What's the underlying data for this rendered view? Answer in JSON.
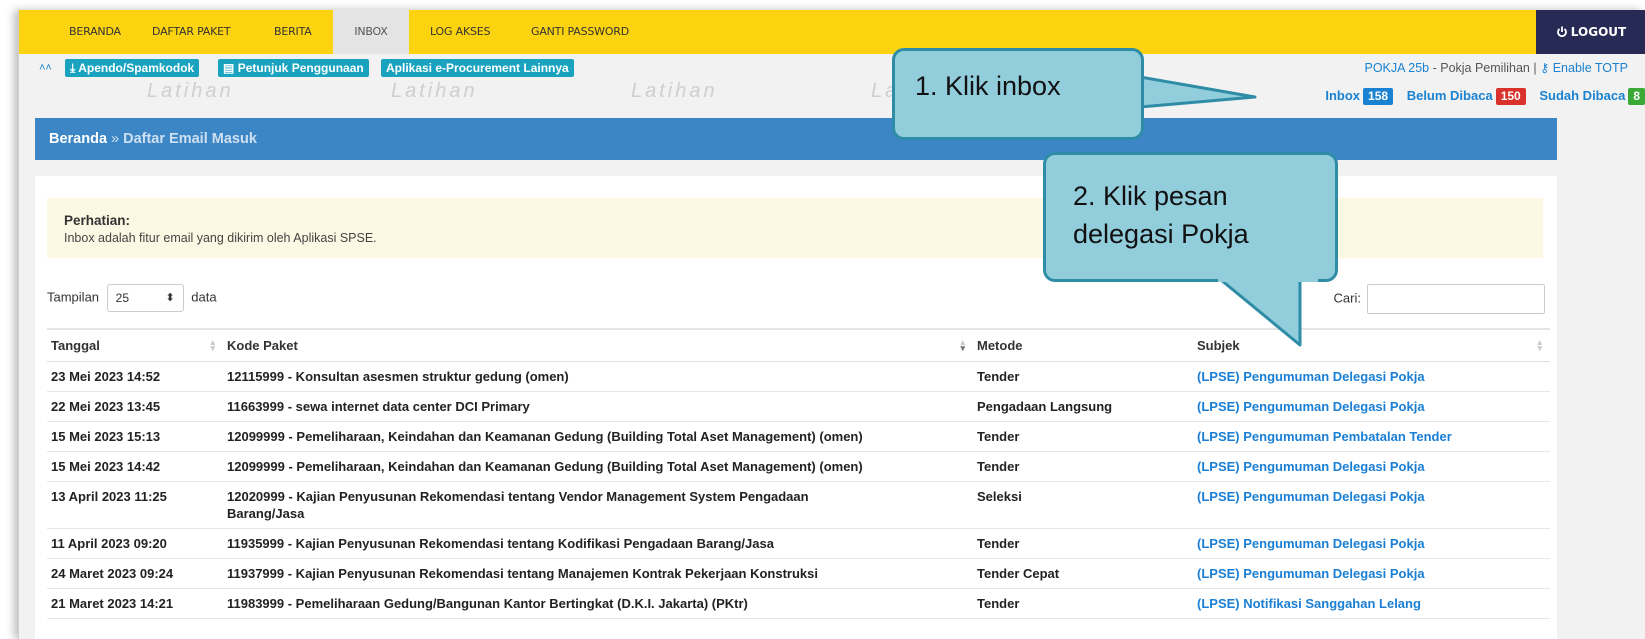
{
  "nav": {
    "items": [
      "BERANDA",
      "DAFTAR PAKET",
      "BERITA",
      "INBOX",
      "LOG AKSES",
      "GANTI PASSWORD"
    ],
    "active": "INBOX",
    "logout": "LOGOUT"
  },
  "toolbar": {
    "buttons": [
      "Apendo/Spamkodok",
      "Petunjuk Penggunaan",
      "Aplikasi e-Procurement Lainnya"
    ],
    "user": "POKJA 25b",
    "role": "- Pokja Pemilihan |",
    "totp": "Enable TOTP"
  },
  "watermark": "Latihan",
  "counters": {
    "inbox_label": "Inbox",
    "inbox_count": "158",
    "inbox_color": "#1a82d0",
    "unread_label": "Belum Dibaca",
    "unread_count": "150",
    "unread_color": "#d9312b",
    "read_label": "Sudah Dibaca",
    "read_count": "8",
    "read_color": "#3aa935"
  },
  "breadcrumb": {
    "home": "Beranda",
    "sep": "»",
    "current": "Daftar Email Masuk"
  },
  "alert": {
    "title": "Perhatian:",
    "text": "Inbox adalah fitur email yang dikirim oleh Aplikasi SPSE."
  },
  "length": {
    "prefix": "Tampilan",
    "value": "25",
    "suffix": "data"
  },
  "search": {
    "label": "Cari:"
  },
  "table": {
    "headers": [
      "Tanggal",
      "Kode Paket",
      "Metode",
      "Subjek"
    ],
    "rows": [
      [
        "23 Mei 2023 14:52",
        "12115999 - Konsultan asesmen struktur gedung (omen)",
        "Tender",
        "(LPSE) Pengumuman Delegasi Pokja"
      ],
      [
        "22 Mei 2023 13:45",
        "11663999 - sewa internet data center DCI Primary",
        "Pengadaan Langsung",
        "(LPSE) Pengumuman Delegasi Pokja"
      ],
      [
        "15 Mei 2023 15:13",
        "12099999 - Pemeliharaan, Keindahan dan Keamanan Gedung (Building Total Aset Management) (omen)",
        "Tender",
        "(LPSE) Pengumuman Pembatalan Tender"
      ],
      [
        "15 Mei 2023 14:42",
        "12099999 - Pemeliharaan, Keindahan dan Keamanan Gedung (Building Total Aset Management) (omen)",
        "Tender",
        "(LPSE) Pengumuman Delegasi Pokja"
      ],
      [
        "13 April 2023 11:25",
        "12020999 - Kajian Penyusunan Rekomendasi tentang Vendor Management System Pengadaan Barang/Jasa",
        "Seleksi",
        "(LPSE) Pengumuman Delegasi Pokja"
      ],
      [
        "11 April 2023 09:20",
        "11935999 - Kajian Penyusunan Rekomendasi tentang Kodifikasi Pengadaan Barang/Jasa",
        "Tender",
        "(LPSE) Pengumuman Delegasi Pokja"
      ],
      [
        "24 Maret 2023 09:24",
        "11937999 - Kajian Penyusunan Rekomendasi tentang Manajemen Kontrak Pekerjaan Konstruksi",
        "Tender Cepat",
        "(LPSE) Pengumuman Delegasi Pokja"
      ],
      [
        "21 Maret 2023 14:21",
        "11983999 - Pemeliharaan Gedung/Bangunan Kantor Bertingkat (D.K.I. Jakarta) (PKtr)",
        "Tender",
        "(LPSE) Notifikasi Sanggahan Lelang"
      ]
    ]
  },
  "callouts": {
    "one": "1.  Klik inbox",
    "two_line1": "2. Klik pesan",
    "two_line2": "delegasi Pokja"
  }
}
